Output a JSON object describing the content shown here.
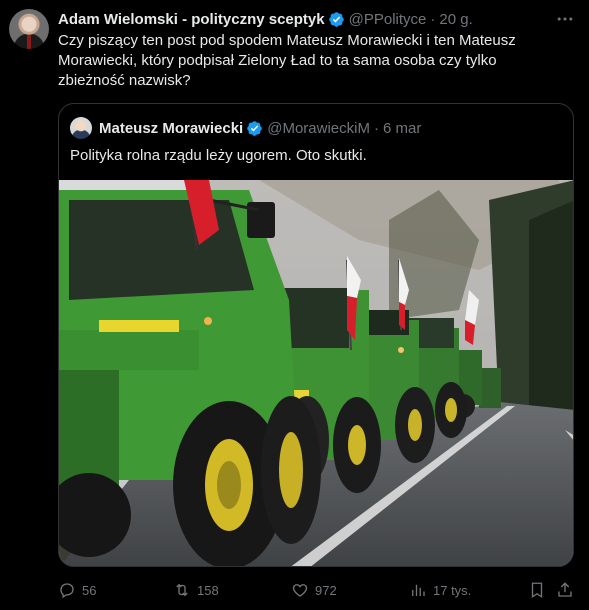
{
  "tweet": {
    "author_name": "Adam Wielomski - polityczny sceptyk",
    "author_handle": "@PPolityce",
    "separator": "·",
    "time": "20 g.",
    "text": "Czy piszący ten post pod spodem Mateusz Morawiecki i ten Mateusz Morawiecki, który podpisał Zielony Ład to ta sama osoba czy tylko zbieżność nazwisk?"
  },
  "quote": {
    "author_name": "Mateusz Morawiecki",
    "author_handle": "@MorawieckiM",
    "separator": "·",
    "time": "6 mar",
    "text": "Polityka rolna rządu leży ugorem. Oto skutki."
  },
  "actions": {
    "replies": "56",
    "reposts": "158",
    "likes": "972",
    "views": "17 tys."
  },
  "colors": {
    "background": "#000000",
    "text": "#e7e9ea",
    "muted": "#71767b",
    "border": "#2f3336",
    "verified": "#1d9bf0"
  }
}
